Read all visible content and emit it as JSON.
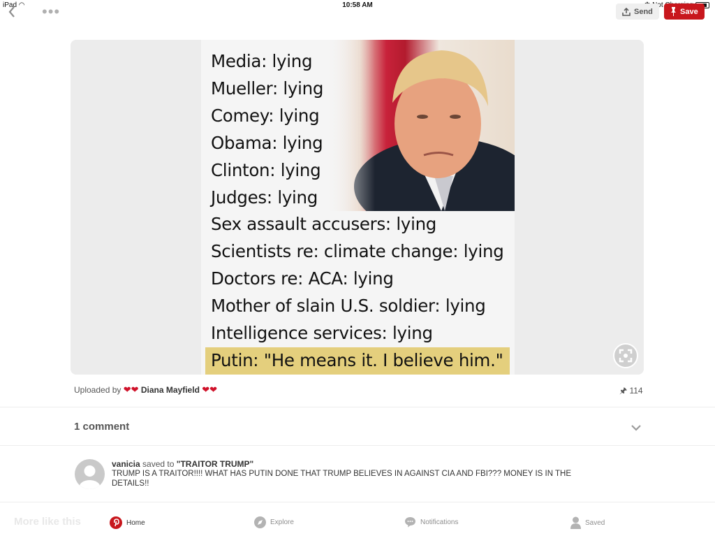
{
  "status_bar": {
    "device": "iPad",
    "time": "10:58 AM",
    "charging": "Not Charging"
  },
  "toolbar": {
    "send_label": "Send",
    "save_label": "Save"
  },
  "meme": {
    "lines": [
      "Media: lying",
      "Mueller: lying",
      "Comey: lying",
      "Obama: lying",
      "Clinton: lying",
      "Judges: lying",
      "Sex assault accusers: lying",
      "Scientists re: climate change: lying",
      "Doctors re: ACA: lying",
      "Mother of slain U.S. soldier: lying",
      "Intelligence services: lying"
    ],
    "highlight_line": "Putin: \"He means it. I believe him.\"",
    "highlight_color": "#e4cf7d"
  },
  "pin": {
    "uploaded_by_prefix": "Uploaded by",
    "uploader_name": "Diana Mayfield",
    "saves_count": "114"
  },
  "comments": {
    "title": "1 comment",
    "items": [
      {
        "user": "vanicia",
        "action": "saved to",
        "board": "\"TRAITOR TRUMP\"",
        "text": "TRUMP IS A TRAITOR!!!! WHAT HAS PUTIN DONE THAT TRUMP BELIEVES IN AGAINST CIA AND FBI??? MONEY IS IN THE DETAILS!!"
      }
    ]
  },
  "more_like_this": "More like this",
  "tabs": [
    {
      "label": "Home",
      "icon": "pinterest-icon",
      "active": true
    },
    {
      "label": "Explore",
      "icon": "compass-icon",
      "active": false
    },
    {
      "label": "Notifications",
      "icon": "speech-bubble-icon",
      "active": false
    },
    {
      "label": "Saved",
      "icon": "person-icon",
      "active": false
    }
  ],
  "colors": {
    "brand_red": "#c8171d",
    "heart_red": "#d0122a"
  }
}
